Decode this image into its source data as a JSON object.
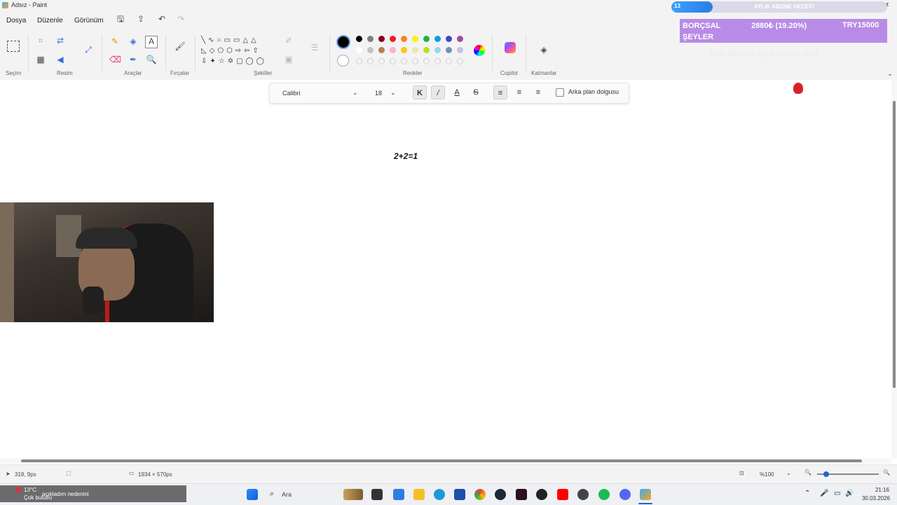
{
  "window": {
    "title": "Adsız - Paint"
  },
  "menu": {
    "items": [
      "Dosya",
      "Düzenle",
      "Görünüm"
    ]
  },
  "ribbon": {
    "groups": {
      "selection": "Seçim",
      "image": "Resim",
      "tools": "Araçlar",
      "brushes": "Fırçalar",
      "shapes": "Şekiller",
      "colors": "Renkler",
      "copilot": "Copilot",
      "layers": "Katmanlar"
    },
    "palette": [
      "#000000",
      "#7f7f7f",
      "#880015",
      "#ed1c24",
      "#ff7f27",
      "#fff200",
      "#22b14c",
      "#00a2e8",
      "#3f48cc",
      "#a349a4",
      "#ffffff",
      "#c3c3c3",
      "#b97a57",
      "#ffaec9",
      "#ffc90e",
      "#efe4b0",
      "#b5e61d",
      "#99d9ea",
      "#7092be",
      "#c8bfe7"
    ],
    "primary_color": "#000000",
    "secondary_color": "#ffffff"
  },
  "text_toolbar": {
    "font": "Calibri",
    "size": "18",
    "bold_label": "K",
    "italic_label": "/",
    "underline_label": "A",
    "strike_label": "S",
    "background_fill_label": "Arka plan dolgusu"
  },
  "canvas": {
    "text": "2+2=1"
  },
  "overlay": {
    "badge": "13",
    "goal_title": "AYLIK ABONE HEDEFİ",
    "goal_label": "BORÇSAL ŞEYLER",
    "goal_amount": "2880₺ (19.20%)",
    "goal_target": "TRY15000",
    "goal_fraction": 0.192,
    "last_sub": "Son Abone: utakmuhendisi"
  },
  "status": {
    "cursor_pos": "319, 9px",
    "canvas_size": "1934 × 570px",
    "zoom": "%100"
  },
  "taskbar": {
    "weather_temp": "13°C",
    "weather_desc": "Çok bulutlu",
    "ticker": "açıkladım nedenini",
    "search_placeholder": "Ara",
    "time": "21:16",
    "date": "30.03.2026"
  }
}
